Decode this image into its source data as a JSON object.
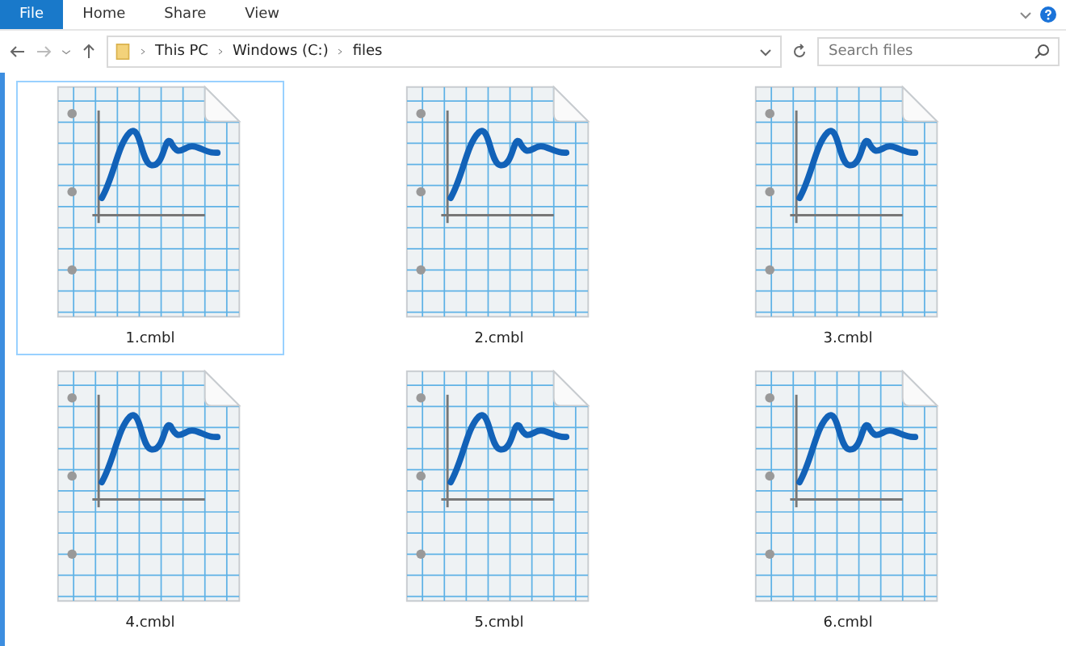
{
  "ribbon": {
    "tabs": [
      {
        "label": "File",
        "selected": true
      },
      {
        "label": "Home",
        "selected": false
      },
      {
        "label": "Share",
        "selected": false
      },
      {
        "label": "View",
        "selected": false
      }
    ]
  },
  "address": {
    "crumbs": [
      "This PC",
      "Windows (C:)",
      "files"
    ]
  },
  "search": {
    "placeholder": "Search files"
  },
  "files": [
    {
      "name": "1.cmbl",
      "selected": true
    },
    {
      "name": "2.cmbl",
      "selected": false
    },
    {
      "name": "3.cmbl",
      "selected": false
    },
    {
      "name": "4.cmbl",
      "selected": false
    },
    {
      "name": "5.cmbl",
      "selected": false
    },
    {
      "name": "6.cmbl",
      "selected": false
    }
  ]
}
